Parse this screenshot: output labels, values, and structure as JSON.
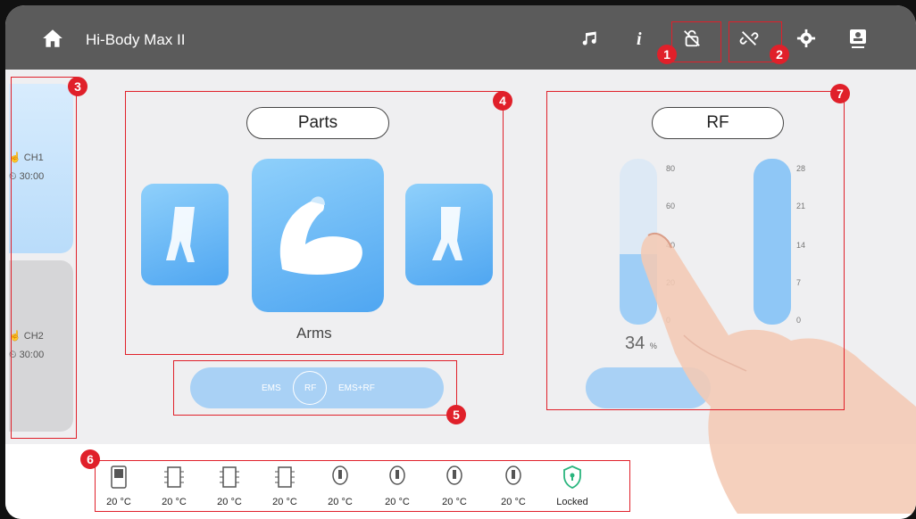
{
  "app": {
    "title": "Hi-Body Max II"
  },
  "annotations": [
    "1",
    "2",
    "3",
    "4",
    "5",
    "6",
    "7"
  ],
  "channels": [
    {
      "name": "CH1",
      "time": "30:00"
    },
    {
      "name": "CH2",
      "time": "30:00"
    }
  ],
  "parts": {
    "title": "Parts",
    "selected_label": "Arms",
    "items": [
      "legs-left-icon",
      "arms-icon",
      "legs-right-icon"
    ]
  },
  "modes": {
    "options": [
      "EMS",
      "RF",
      "EMS+RF"
    ],
    "selected": "RF"
  },
  "rf": {
    "title": "RF",
    "intensity_scale": [
      "80",
      "60",
      "40",
      "20",
      "0"
    ],
    "intensity_value_percent": 34,
    "intensity_unit": "%",
    "time_scale": [
      "28",
      "21",
      "14",
      "7",
      "0"
    ],
    "time_value_fraction": 1.0
  },
  "devices": {
    "temps": [
      "20 °C",
      "20 °C",
      "20 °C",
      "20 °C",
      "20 °C",
      "20 °C",
      "20 °C",
      "20 °C"
    ],
    "lock_label": "Locked"
  },
  "colors": {
    "accent": "#4fa6f1",
    "marker": "#e0202a",
    "topbar": "#5b5b5b"
  }
}
